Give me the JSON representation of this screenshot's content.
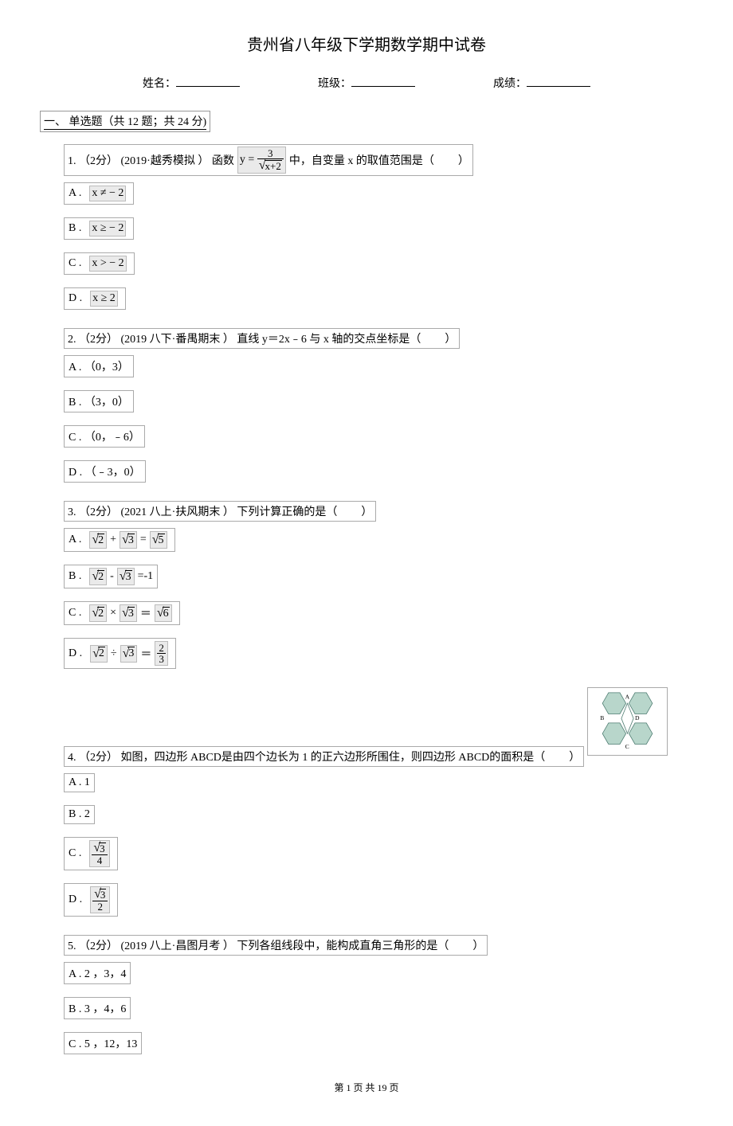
{
  "title": "贵州省八年级下学期数学期中试卷",
  "info": {
    "name_label": "姓名：",
    "class_label": "班级：",
    "score_label": "成绩："
  },
  "section1": {
    "header": "一、 单选题（共 12 题；共 24 分)"
  },
  "q1": {
    "prefix": "1. （2分） (2019·越秀模拟 ） 函数 ",
    "formula_text": "y = 3 / √(x+2)",
    "suffix": " 中，自变量 x 的取值范围是（",
    "end": "）",
    "A": "A .",
    "A_expr": "x ≠ − 2",
    "B": "B .",
    "B_expr": "x ≥ − 2",
    "C": "C .",
    "C_expr": "x > − 2",
    "D": "D .",
    "D_expr": "x ≥ 2"
  },
  "q2": {
    "text": "2. （2分） (2019 八下·番禺期末 ） 直线 y＝2x﹣6 与 x 轴的交点坐标是（",
    "end": "）",
    "A": "A . （0，3）",
    "B": "B . （3，0）",
    "C": "C . （0，﹣6）",
    "D": "D . （﹣3，0）"
  },
  "q3": {
    "text": "3. （2分） (2021 八上·扶风期末 ） 下列计算正确的是（",
    "end": "）",
    "A": "A .",
    "A_mid": " + ",
    "A_eq": " = ",
    "A_s1": "2",
    "A_s2": "3",
    "A_s3": "5",
    "B": "B .",
    "B_mid": " - ",
    "B_eq": " =-1",
    "B_s1": "2",
    "B_s2": "3",
    "C": "C .",
    "C_mid": " × ",
    "C_eq": " ＝ ",
    "C_s1": "2",
    "C_s2": "3",
    "C_s3": "6",
    "D": "D .",
    "D_mid": " ÷ ",
    "D_eq": " ＝ ",
    "D_s1": "2",
    "D_s2": "3",
    "D_frac_num": "2",
    "D_frac_den": "3"
  },
  "q4": {
    "text": "4. （2分） 如图，四边形 ABCD是由四个边长为 1 的正六边形所围住，则四边形 ABCD的面积是（",
    "end": "）",
    "labels": {
      "A": "A",
      "B": "B",
      "C": "C",
      "D": "D"
    },
    "optA": "A . 1",
    "optB": "B . 2",
    "optC": "C .",
    "optC_num": "√3",
    "optC_num_raw": "3",
    "optC_den": "4",
    "optD": "D .",
    "optD_num_raw": "3",
    "optD_den": "2"
  },
  "q5": {
    "text": "5. （2分） (2019 八上·昌图月考 ） 下列各组线段中，能构成直角三角形的是（",
    "end": "）",
    "A": "A . 2 ，3，4",
    "B": "B . 3 ，4，6",
    "C": "C . 5 ，12，13"
  },
  "footer": "第 1 页 共 19 页"
}
